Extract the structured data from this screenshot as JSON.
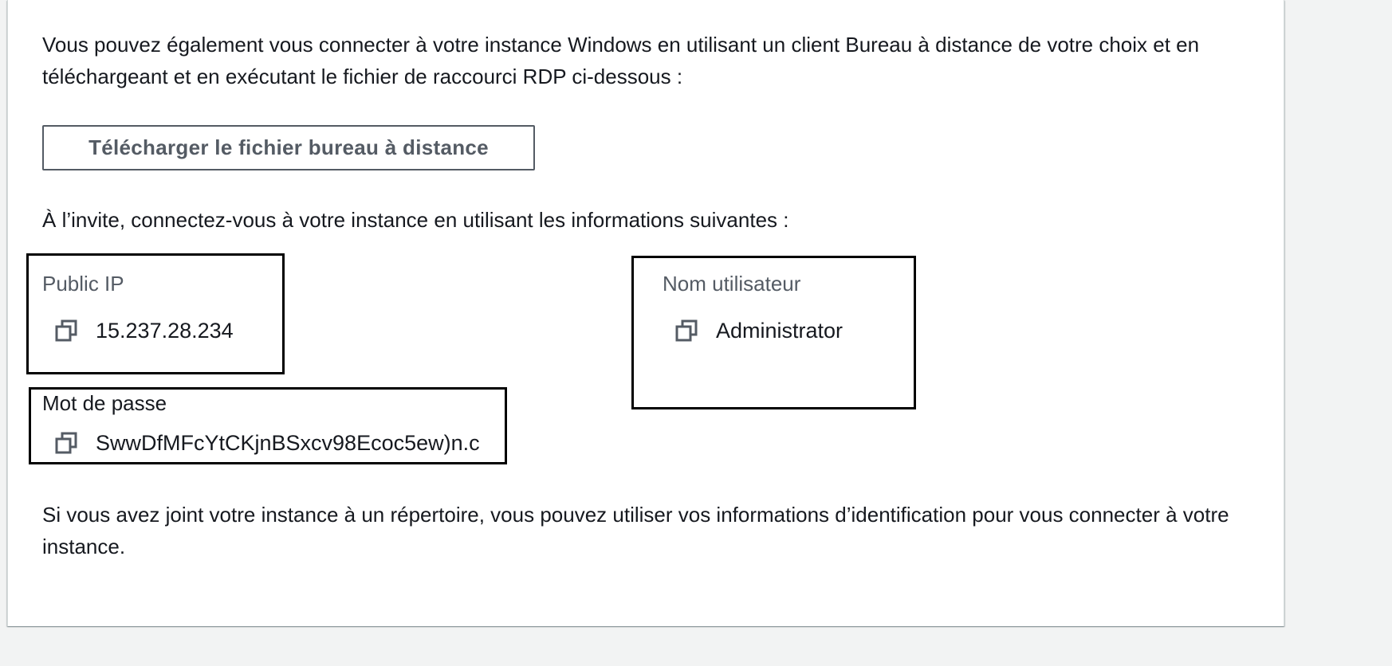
{
  "instructions": {
    "intro": "Vous pouvez également vous connecter à votre instance Windows en utilisant un client Bureau à distance de votre choix et en téléchargeant et en exécutant le fichier de raccourci RDP ci-dessous :",
    "download_button_label": "Télécharger le fichier bureau à distance",
    "prompt": "À l’invite, connectez-vous à votre instance en utilisant les informations suivantes :",
    "outro": "Si vous avez joint votre instance à un répertoire, vous pouvez utiliser vos informations d’identification pour vous connecter à votre instance."
  },
  "credentials": {
    "public_ip": {
      "label": "Public IP",
      "value": "15.237.28.234",
      "icon": "copy-icon"
    },
    "username": {
      "label": "Nom utilisateur",
      "value": "Administrator",
      "icon": "copy-icon"
    },
    "password": {
      "label": "Mot de passe",
      "value": "SwwDfMFcYtCKjnBSxcv98Ecoc5ew)n.c",
      "icon": "copy-icon"
    }
  },
  "colors": {
    "page_background": "#f2f3f3",
    "panel_background": "#ffffff",
    "text_primary": "#16191f",
    "text_secondary": "#545b64",
    "highlight_border": "#000000"
  }
}
